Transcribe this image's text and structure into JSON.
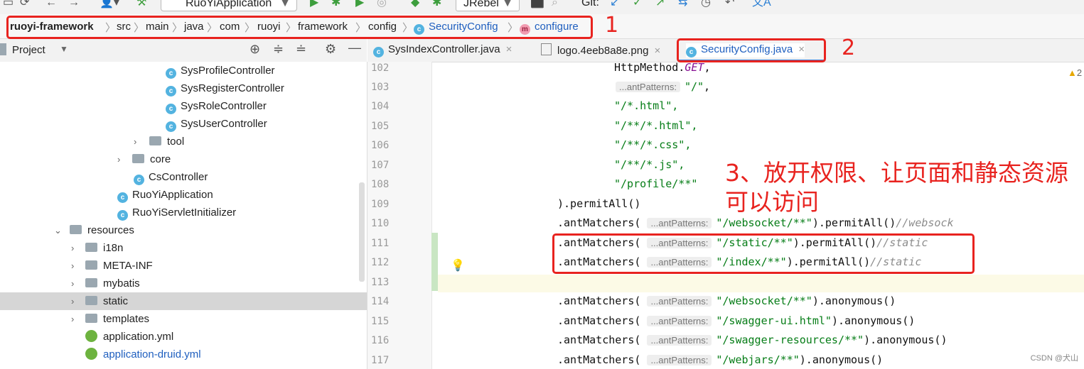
{
  "toolbar": {
    "run_config": "RuoYiApplication",
    "jrebel": "JRebel",
    "git_label": "Git:"
  },
  "breadcrumb": [
    "ruoyi-framework",
    "src",
    "main",
    "java",
    "com",
    "ruoyi",
    "framework",
    "config",
    "SecurityConfig",
    "configure"
  ],
  "project": {
    "title": "Project",
    "tree": [
      {
        "label": "SysProfileController",
        "icon": "c"
      },
      {
        "label": "SysRegisterController",
        "icon": "c"
      },
      {
        "label": "SysRoleController",
        "icon": "c"
      },
      {
        "label": "SysUserController",
        "icon": "c"
      },
      {
        "label": "tool",
        "icon": "folder"
      },
      {
        "label": "core",
        "icon": "folder"
      },
      {
        "label": "CsController",
        "icon": "c"
      },
      {
        "label": "RuoYiApplication",
        "icon": "c"
      },
      {
        "label": "RuoYiServletInitializer",
        "icon": "c"
      },
      {
        "label": "resources",
        "icon": "folder"
      },
      {
        "label": "i18n",
        "icon": "folder"
      },
      {
        "label": "META-INF",
        "icon": "folder"
      },
      {
        "label": "mybatis",
        "icon": "folder"
      },
      {
        "label": "static",
        "icon": "folder"
      },
      {
        "label": "templates",
        "icon": "folder"
      },
      {
        "label": "application.yml",
        "icon": "yml"
      },
      {
        "label": "application-druid.yml",
        "icon": "yml"
      }
    ]
  },
  "tabs": [
    "SysIndexController.java",
    "logo.4eeb8a8e.png",
    "SecurityConfig.java"
  ],
  "annotations": {
    "one": "1",
    "two": "2",
    "three_line1": "3、放开权限、让页面和静态资源",
    "three_line2": "可以访问"
  },
  "code": {
    "line_numbers": [
      "102",
      "103",
      "104",
      "105",
      "106",
      "107",
      "108",
      "109",
      "110",
      "111",
      "112",
      "113",
      "114",
      "115",
      "116",
      "117"
    ],
    "hint": "...antPatterns:",
    "l102_a": "HttpMethod.",
    "l102_b": "GET",
    "l102_c": ",",
    "l103_str": "\"/\"",
    "l103_c": ",",
    "l104": "\"/*.html\",",
    "l105": "\"/**/*.html\",",
    "l106": "\"/**/*.css\",",
    "l107": "\"/**/*.js\",",
    "l108": "\"/profile/**\"",
    "l109": ").permitAll()",
    "ant": ".antMatchers(",
    "l110_str": "\"/websocket/**\"",
    "l110_tail": ").permitAll()",
    "l110_cmt": "//websock",
    "l111_str": "\"/static/**\"",
    "l111_tail": ").permitAll()",
    "l111_cmt": "//static",
    "l112_str": "\"/index/**\"",
    "l112_tail": ").permitAll()",
    "l112_cmt": "//static",
    "l114_str": "\"/websocket/**\"",
    "l114_tail": ").anonymous()",
    "l115_str": "\"/swagger-ui.html\"",
    "l115_tail": ").anonymous()",
    "l116_str": "\"/swagger-resources/**\"",
    "l116_tail": ").anonymous()",
    "l117_str": "\"/webjars/**\"",
    "l117_tail": ").anonymous()"
  },
  "warning_count": "2",
  "watermark": "CSDN @犬山"
}
